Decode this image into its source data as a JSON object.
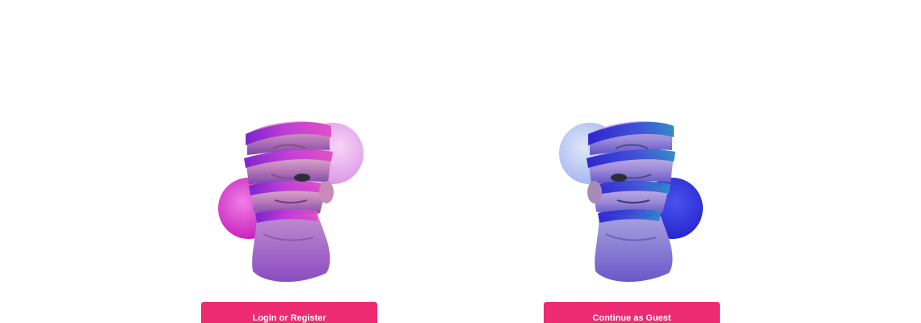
{
  "options": [
    {
      "id": "login",
      "button_label": "Login or Register",
      "art_icon": "sculpture-head-pink-illustration",
      "palette": [
        "#e01fb8",
        "#f1b7f0",
        "#9c34d6",
        "#c98ad0"
      ]
    },
    {
      "id": "guest",
      "button_label": "Continue as Guest",
      "art_icon": "sculpture-head-blue-illustration",
      "palette": [
        "#2b2fd6",
        "#b9c7f3",
        "#5a4fd8",
        "#a8a8e6"
      ]
    }
  ],
  "colors": {
    "button_bg": "#ec2b72",
    "button_text": "#ffffff",
    "page_bg": "#ffffff"
  }
}
